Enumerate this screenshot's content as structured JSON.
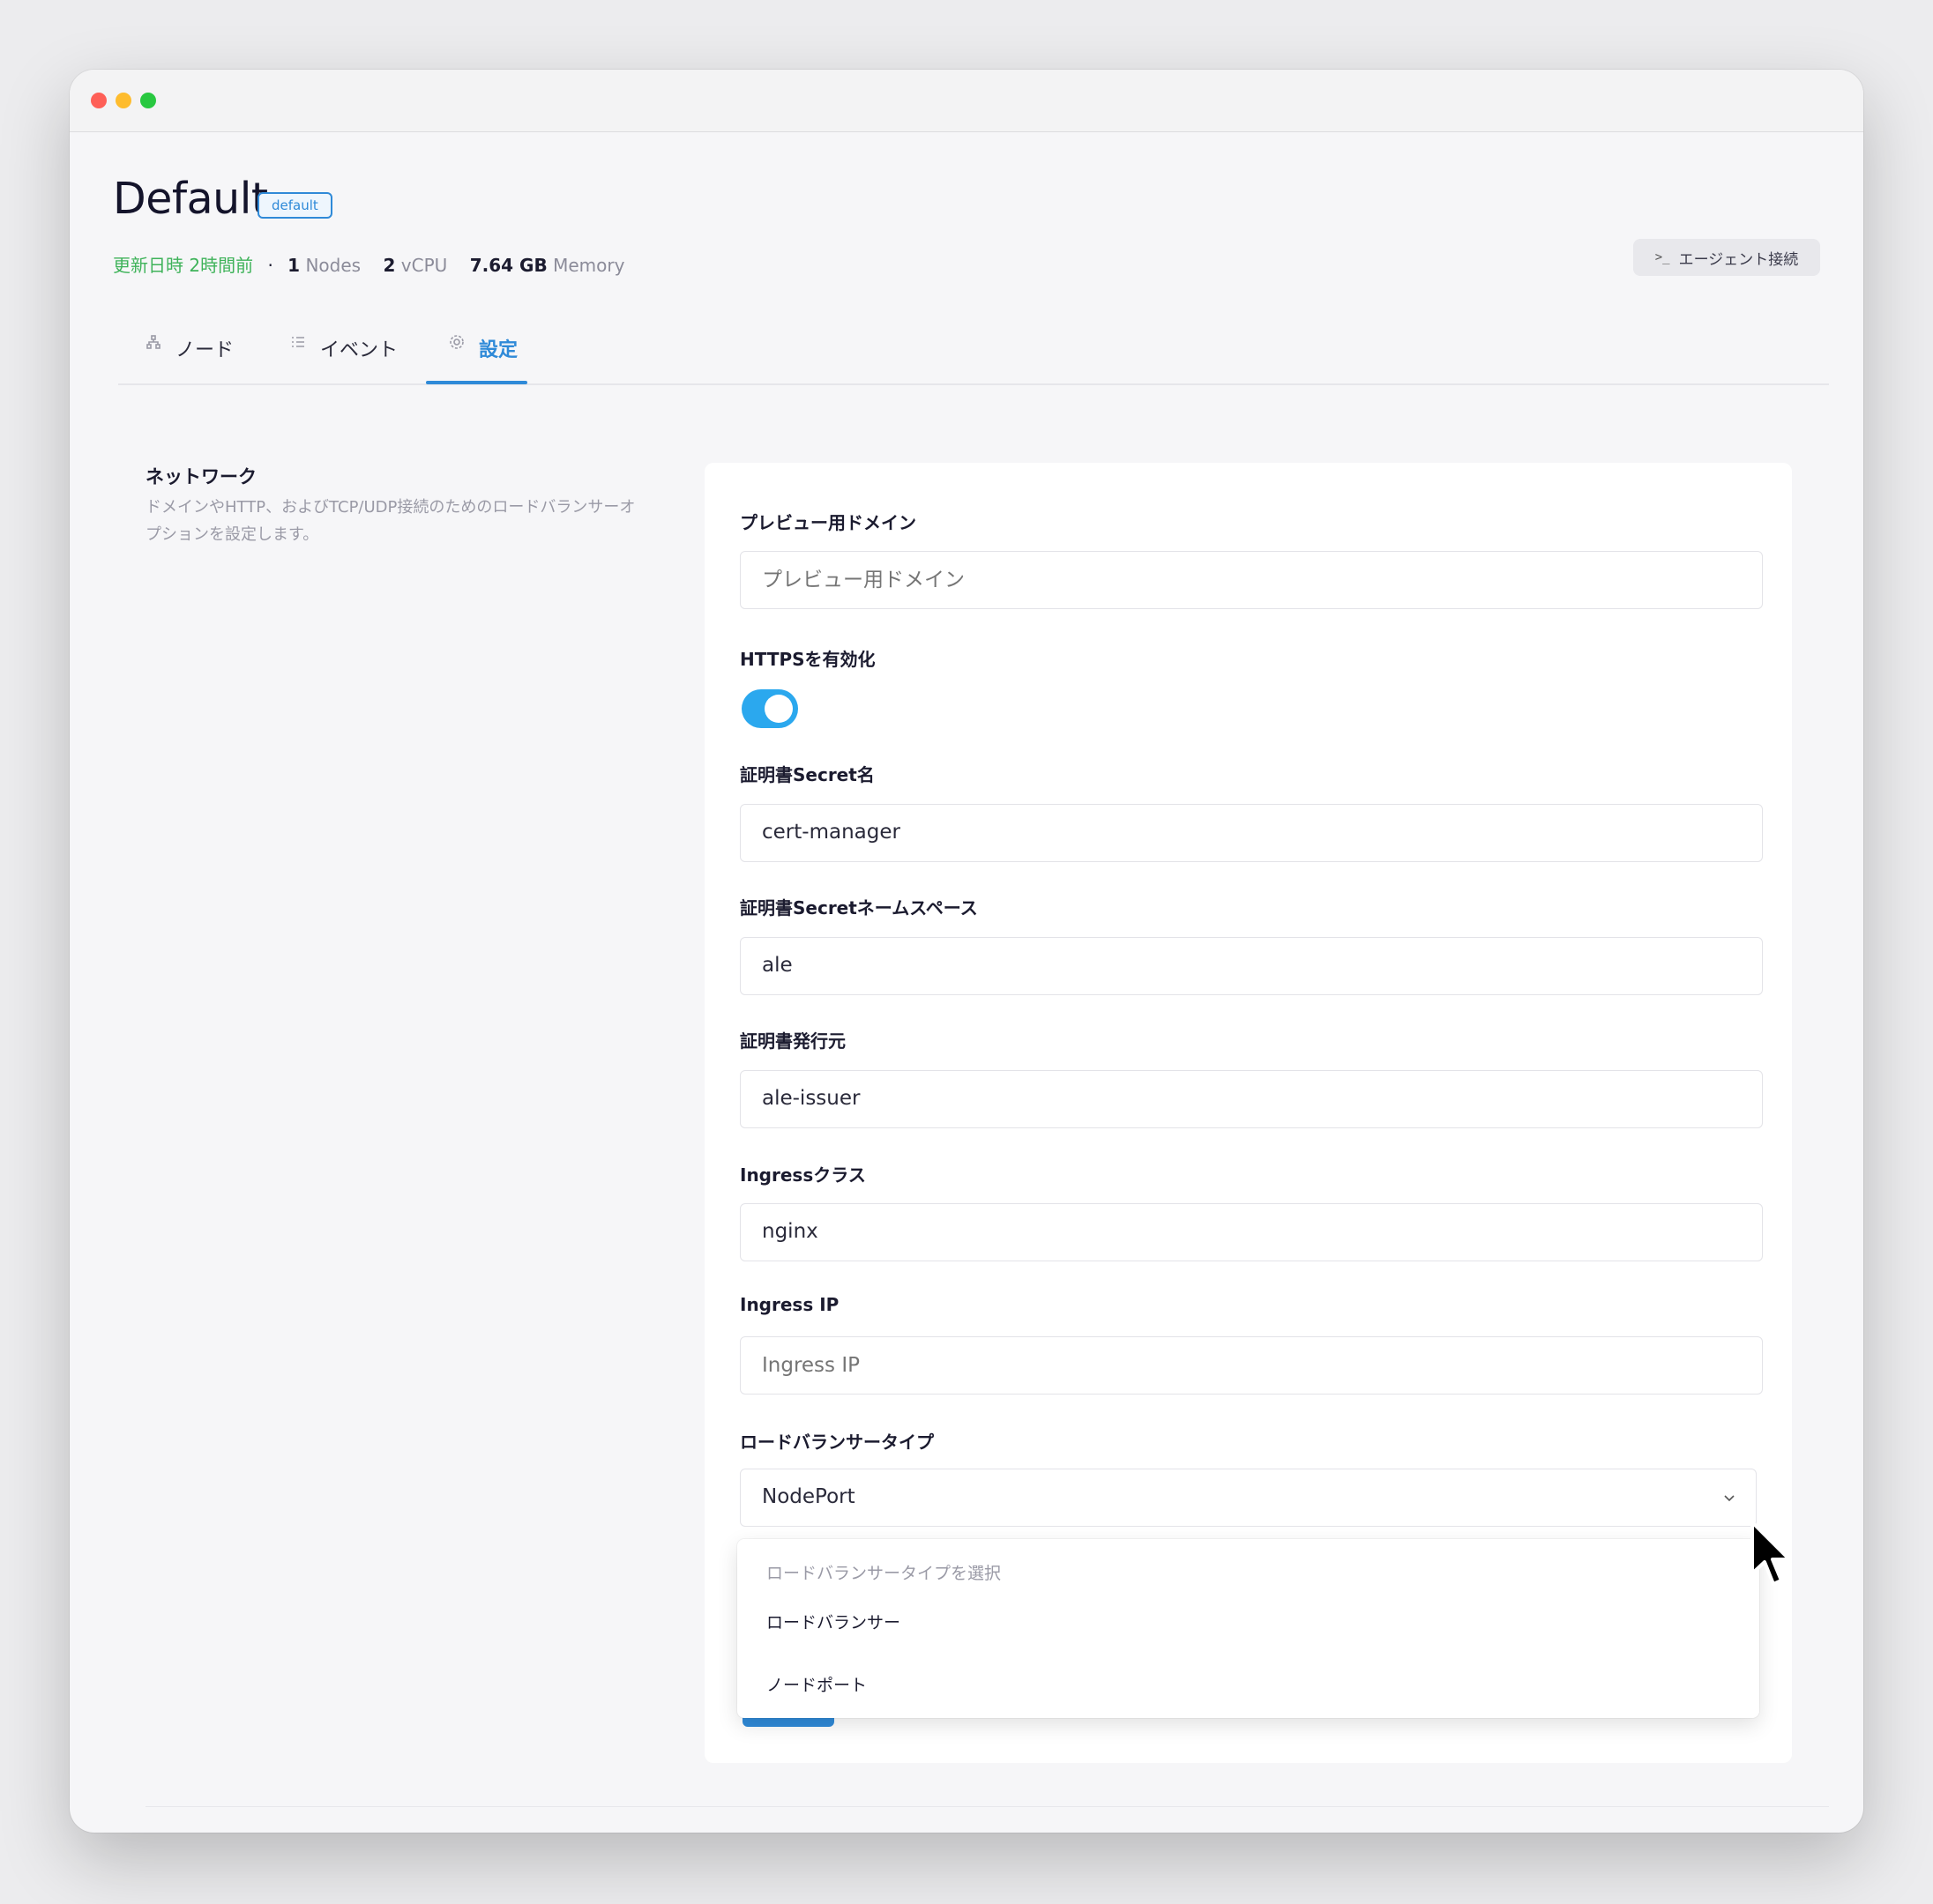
{
  "header": {
    "title": "Default",
    "badge": "default",
    "meta": {
      "updated": "更新日時 2時間前",
      "separator": "·",
      "nodes_count": "1",
      "nodes_label": "Nodes",
      "vcpu_count": "2",
      "vcpu_label": "vCPU",
      "memory_value": "7.64 GB",
      "memory_label": "Memory"
    },
    "agent_button": {
      "icon": ">_",
      "label": "エージェント接続"
    }
  },
  "tabs": [
    {
      "label": "ノード",
      "icon": "network-icon"
    },
    {
      "label": "イベント",
      "icon": "list-icon"
    },
    {
      "label": "設定",
      "icon": "gear-icon",
      "active": true
    }
  ],
  "section": {
    "title": "ネットワーク",
    "description": "ドメインやHTTP、およびTCP/UDP接続のためのロードバランサーオプションを設定します。"
  },
  "form": {
    "preview_domain": {
      "label": "プレビュー用ドメイン",
      "placeholder": "プレビュー用ドメイン",
      "value": ""
    },
    "https": {
      "label": "HTTPSを有効化",
      "enabled": true
    },
    "cert_secret_name": {
      "label": "証明書Secret名",
      "value": "cert-manager"
    },
    "cert_secret_namespace": {
      "label": "証明書Secretネームスペース",
      "value": "ale"
    },
    "cert_issuer": {
      "label": "証明書発行元",
      "value": "ale-issuer"
    },
    "ingress_class": {
      "label": "Ingressクラス",
      "value": "nginx"
    },
    "ingress_ip": {
      "label": "Ingress IP",
      "placeholder": "Ingress IP",
      "value": ""
    },
    "lb_type": {
      "label": "ロードバランサータイプ",
      "selected": "NodePort",
      "dropdown_header": "ロードバランサータイプを選択",
      "options": [
        "ロードバランサー",
        "ノードポート"
      ]
    }
  },
  "colors": {
    "accent": "#2f8ad8",
    "toggle_on": "#2ba8ee",
    "updated_text": "#3fb35a"
  }
}
